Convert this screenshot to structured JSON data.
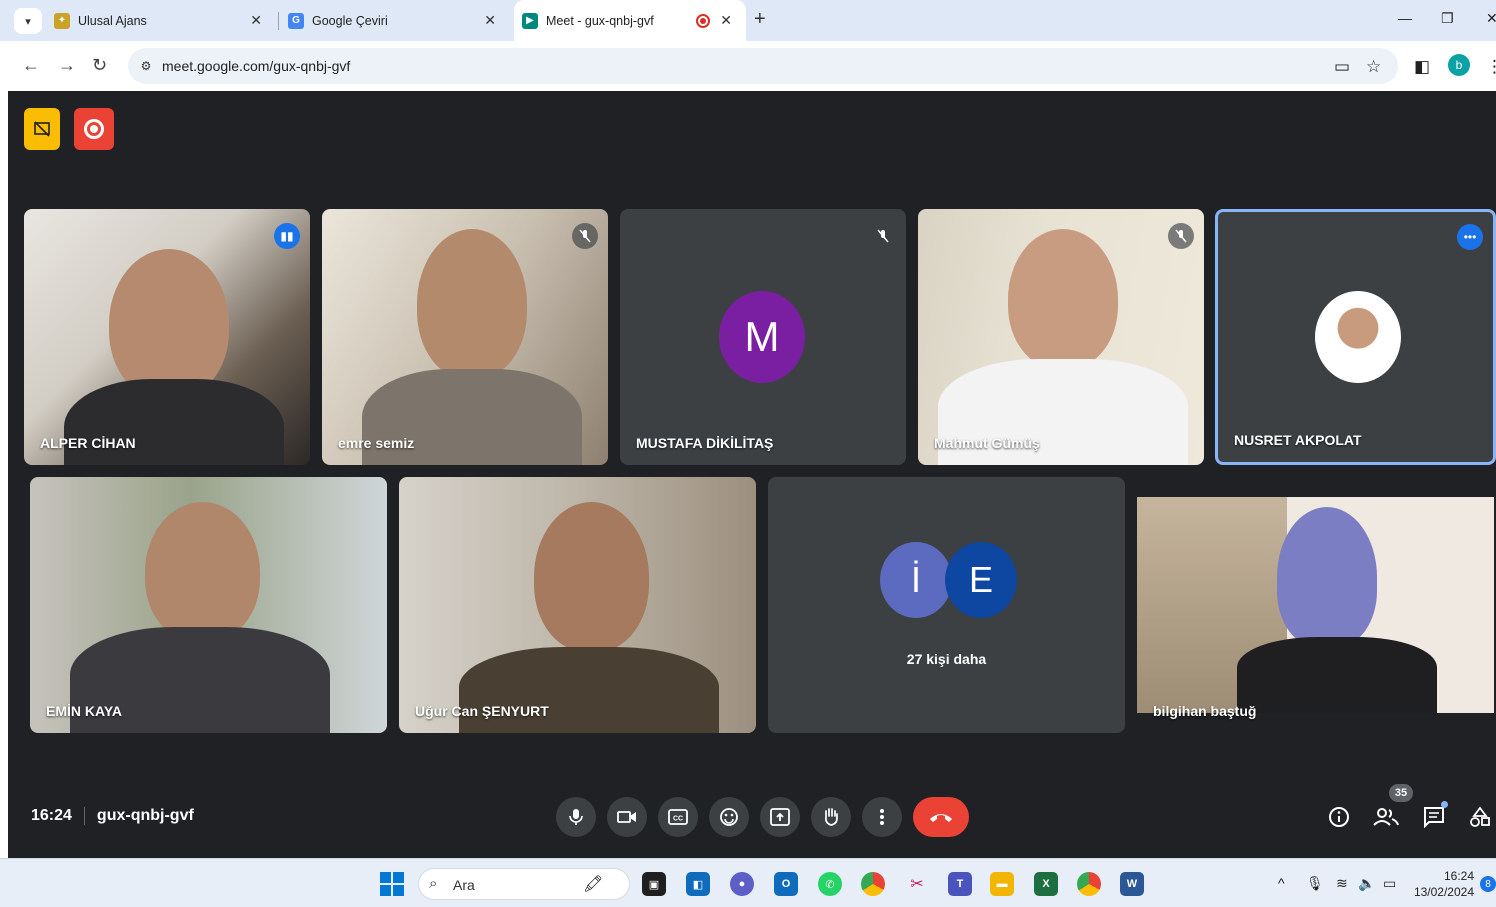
{
  "browser": {
    "tabs": [
      {
        "label": "Ulusal Ajans"
      },
      {
        "label": "Google Çeviri"
      },
      {
        "label": "Meet - gux-qnbj-gvf"
      }
    ],
    "url": "meet.google.com/gux-qnbj-gvf",
    "profile_initial": "b"
  },
  "meet": {
    "participants": [
      {
        "name": "ALPER CİHAN"
      },
      {
        "name": "emre semiz"
      },
      {
        "name": "MUSTAFA DİKİLİTAŞ",
        "avatar_letter": "M",
        "avatar_color": "#7b1fa2"
      },
      {
        "name": "Mahmut Gümüş"
      },
      {
        "name": "NUSRET AKPOLAT"
      },
      {
        "name": "EMİN KAYA"
      },
      {
        "name": "Uğur Can ŞENYURT"
      },
      {
        "name": "bilgihan baştuğ"
      }
    ],
    "more_tile": {
      "avatars": [
        {
          "letter": "İ",
          "color": "#5c6bc0"
        },
        {
          "letter": "E",
          "color": "#0d47a1"
        }
      ],
      "label": "27 kişi daha"
    },
    "time": "16:24",
    "meeting_code": "gux-qnbj-gvf",
    "participant_count": "35"
  },
  "taskbar": {
    "search_label": "Ara",
    "time": "16:24",
    "date": "13/02/2024",
    "notifications": "8"
  }
}
